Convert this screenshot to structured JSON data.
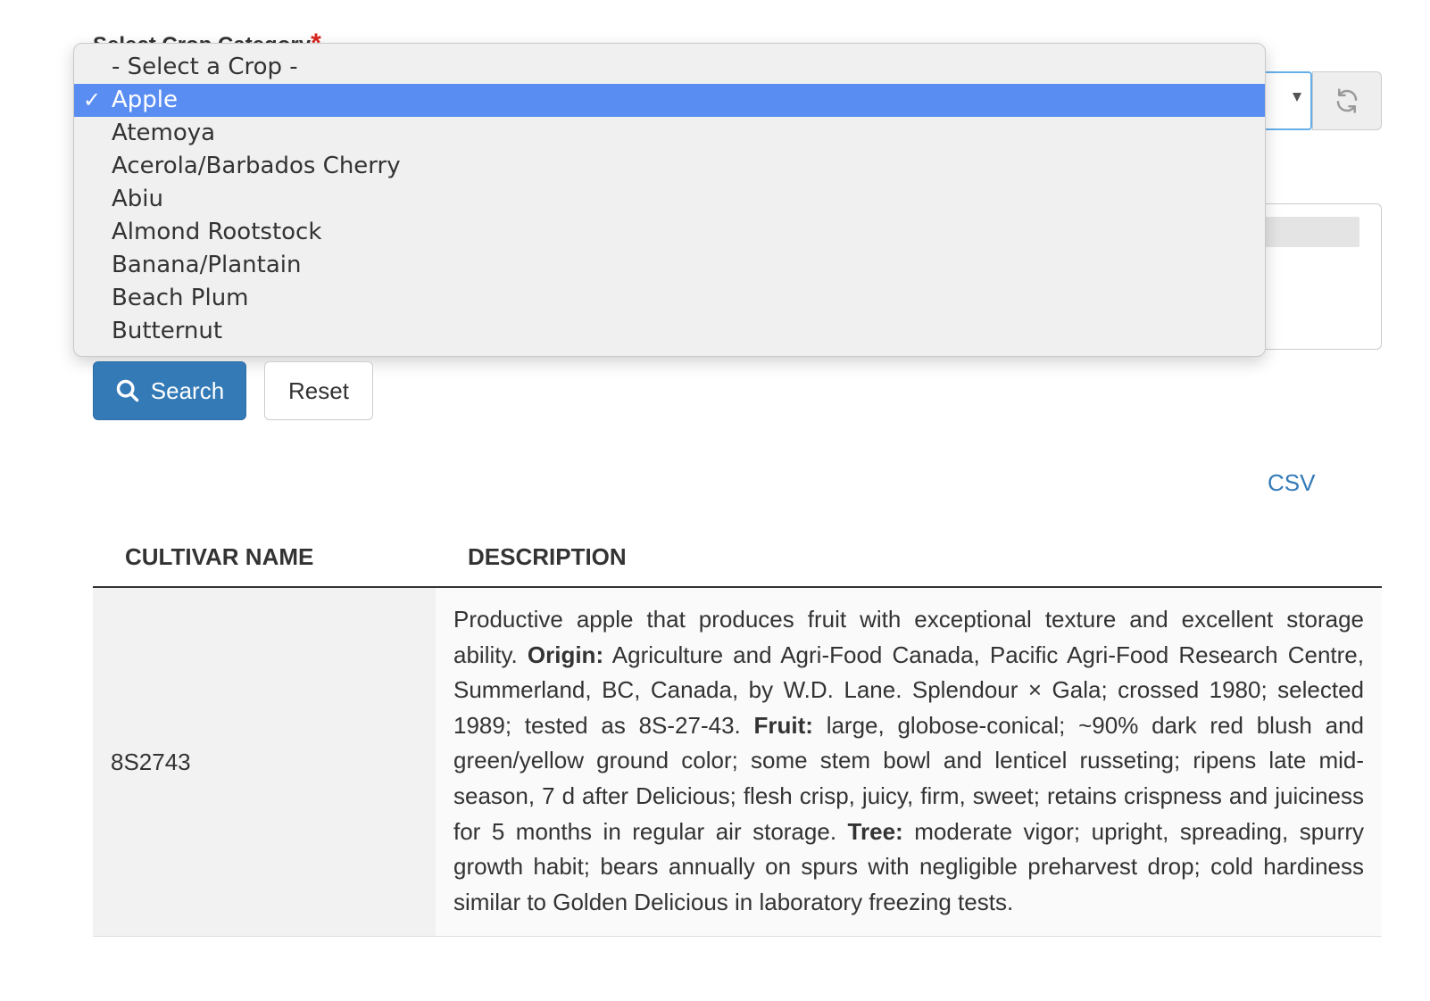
{
  "form": {
    "crop_label": "Select Crop Category",
    "required_mark": "*",
    "selected_crop": "Apple"
  },
  "dropdown": {
    "options": [
      {
        "label": "- Select a Crop -",
        "selected": false
      },
      {
        "label": "Apple",
        "selected": true
      },
      {
        "label": "Atemoya",
        "selected": false
      },
      {
        "label": "Acerola/Barbados Cherry",
        "selected": false
      },
      {
        "label": "Abiu",
        "selected": false
      },
      {
        "label": "Almond Rootstock",
        "selected": false
      },
      {
        "label": "Banana/Plantain",
        "selected": false
      },
      {
        "label": "Beach Plum",
        "selected": false
      },
      {
        "label": "Butternut",
        "selected": false
      }
    ],
    "check_mark": "✓"
  },
  "buttons": {
    "search_label": "Search",
    "reset_label": "Reset",
    "search_icon": "search-icon",
    "refresh_icon": "refresh-icon"
  },
  "export": {
    "csv_label": "CSV"
  },
  "table": {
    "headers": {
      "name": "CULTIVAR NAME",
      "description": "DESCRIPTION"
    },
    "rows": [
      {
        "name": "8S2743",
        "description": {
          "intro": "Productive apple that produces fruit with exceptional texture and excellent storage ability.",
          "origin_label": "Origin:",
          "origin_text": "Agriculture and Agri-Food Canada, Pacific Agri-Food Research Centre, Summerland, BC, Canada, by W.D. Lane. Splendour × Gala; crossed 1980; selected 1989; tested as 8S-27-43.",
          "fruit_label": "Fruit:",
          "fruit_text": "large, globose-conical; ~90% dark red blush and green/yellow ground color; some stem bowl and lenticel russeting; ripens late mid-season, 7 d after Delicious; flesh crisp, juicy, firm, sweet; retains crispness and juiciness for 5 months in regular air storage.",
          "tree_label": "Tree:",
          "tree_text": "moderate vigor; upright, spreading, spurry growth habit; bears annually on spurs with negligible preharvest drop; cold hardiness similar to Golden Delicious in laboratory freezing tests."
        }
      }
    ]
  },
  "colors": {
    "primary": "#337ab7",
    "selected_option": "#5a8df2",
    "required": "#d9251d"
  }
}
